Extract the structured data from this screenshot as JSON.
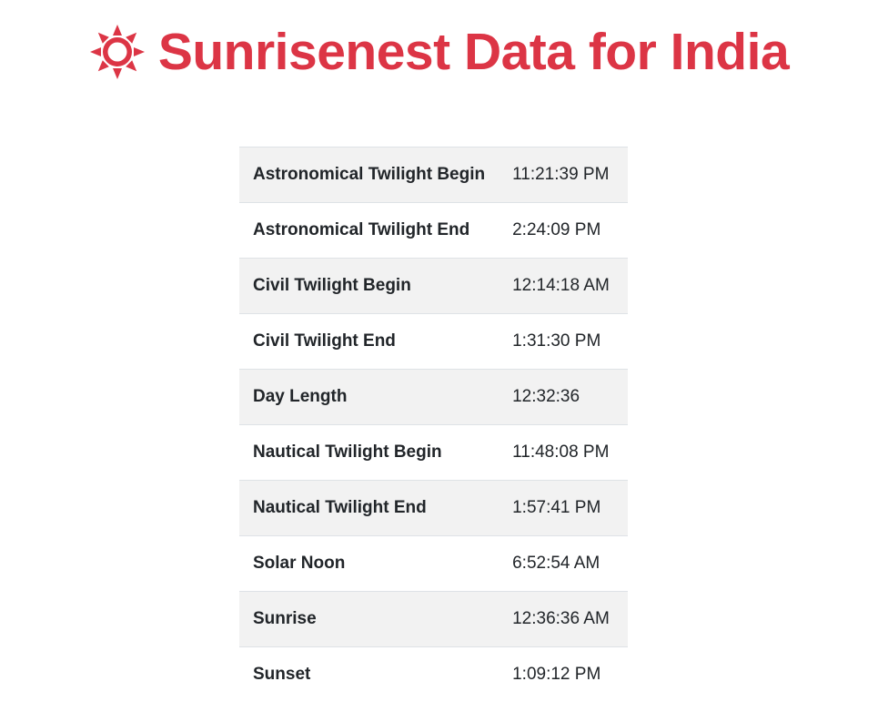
{
  "header": {
    "title": "Sunrisenest Data for India",
    "icon": "sun-icon",
    "accent_color": "#dc3545"
  },
  "table": {
    "rows": [
      {
        "label": "Astronomical Twilight Begin",
        "value": "11:21:39 PM"
      },
      {
        "label": "Astronomical Twilight End",
        "value": "2:24:09 PM"
      },
      {
        "label": "Civil Twilight Begin",
        "value": "12:14:18 AM"
      },
      {
        "label": "Civil Twilight End",
        "value": "1:31:30 PM"
      },
      {
        "label": "Day Length",
        "value": "12:32:36"
      },
      {
        "label": "Nautical Twilight Begin",
        "value": "11:48:08 PM"
      },
      {
        "label": "Nautical Twilight End",
        "value": "1:57:41 PM"
      },
      {
        "label": "Solar Noon",
        "value": "6:52:54 AM"
      },
      {
        "label": "Sunrise",
        "value": "12:36:36 AM"
      },
      {
        "label": "Sunset",
        "value": "1:09:12 PM"
      }
    ]
  }
}
